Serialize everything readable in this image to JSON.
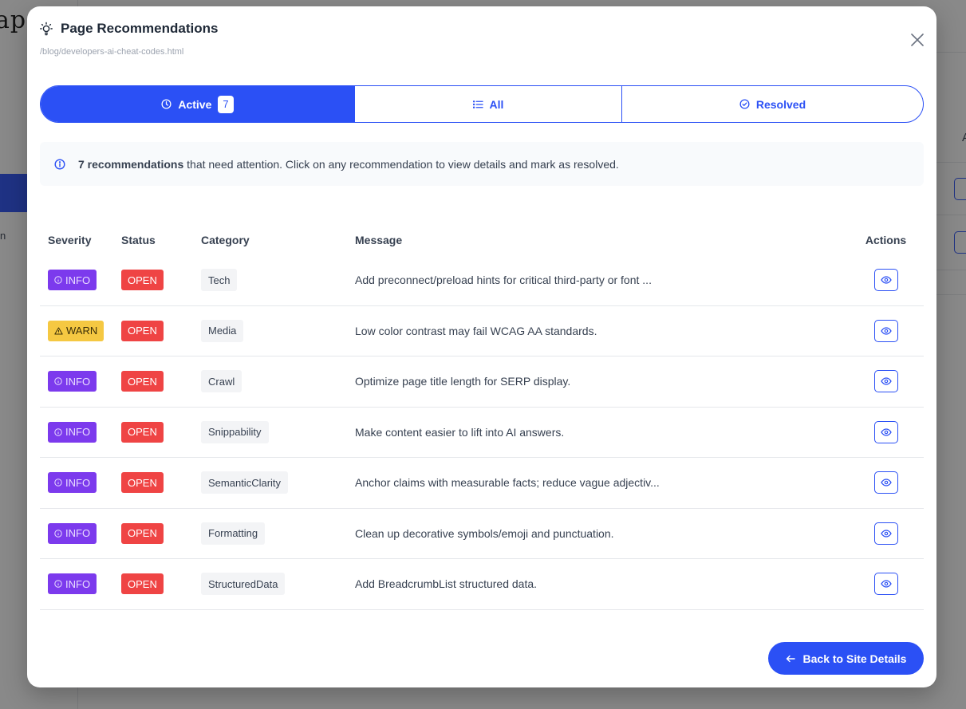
{
  "background": {
    "logo_text": "ap",
    "nav_text": "n",
    "panel_letter": "A"
  },
  "modal": {
    "title": "Page Recommendations",
    "path": "/blog/developers-ai-cheat-codes.html"
  },
  "tabs": [
    {
      "label": "Active",
      "count": "7"
    },
    {
      "label": "All"
    },
    {
      "label": "Resolved"
    }
  ],
  "notice": {
    "bold": "7 recommendations",
    "text": " that need attention. Click on any recommendation to view details and mark as resolved."
  },
  "table": {
    "headers": [
      "Severity",
      "Status",
      "Category",
      "Message",
      "Actions"
    ],
    "rows": [
      {
        "severity": "INFO",
        "status": "OPEN",
        "category": "Tech",
        "message": "Add preconnect/preload hints for critical third-party or font ..."
      },
      {
        "severity": "WARN",
        "status": "OPEN",
        "category": "Media",
        "message": "Low color contrast may fail WCAG AA standards."
      },
      {
        "severity": "INFO",
        "status": "OPEN",
        "category": "Crawl",
        "message": "Optimize page title length for SERP display."
      },
      {
        "severity": "INFO",
        "status": "OPEN",
        "category": "Snippability",
        "message": "Make content easier to lift into AI answers."
      },
      {
        "severity": "INFO",
        "status": "OPEN",
        "category": "SemanticClarity",
        "message": "Anchor claims with measurable facts; reduce vague adjectiv..."
      },
      {
        "severity": "INFO",
        "status": "OPEN",
        "category": "Formatting",
        "message": "Clean up decorative symbols/emoji and punctuation."
      },
      {
        "severity": "INFO",
        "status": "OPEN",
        "category": "StructuredData",
        "message": "Add BreadcrumbList structured data."
      }
    ]
  },
  "footer": {
    "back_label": "Back to Site Details"
  },
  "colors": {
    "primary": "#2b50f5",
    "info": "#7c3aed",
    "warn": "#f5c842",
    "open": "#ef4444"
  }
}
